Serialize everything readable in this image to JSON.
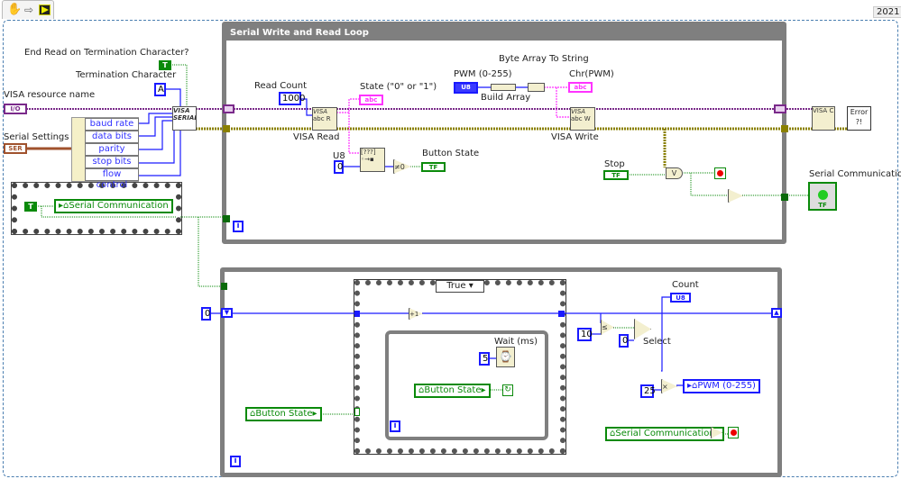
{
  "toolbar": {
    "icons": [
      "hand-icon",
      "step-arrow-icon",
      "run-vi-icon"
    ],
    "version": "2021"
  },
  "top_left": {
    "end_read_label": "End Read on Termination Character?",
    "end_read_value": "T",
    "term_char_label": "Termination Character",
    "term_char_value": "A",
    "visa_resource_label": "VISA resource name",
    "visa_resource_type": "I/O",
    "serial_settings_label": "Serial Settings",
    "serial_settings_type": "SER",
    "cluster_items": [
      "baud rate",
      "data bits",
      "parity",
      "stop bits",
      "flow control"
    ],
    "visa_config_label": "VISA SERIAL",
    "seq_const": "T",
    "seq_local": "Serial Communication"
  },
  "loop1": {
    "title": "Serial Write and Read Loop",
    "read_count_label": "Read Count",
    "read_count_value": "1000",
    "visa_read_label": "VISA Read",
    "state_label": "State (\"0\" or \"1\")",
    "state_type": "abc",
    "u8_label": "U8",
    "u8_value": "0",
    "neq0": "≠0",
    "button_state_label": "Button State",
    "button_state_type": "TF",
    "byte_array_label": "Byte Array To String",
    "pwm_label": "PWM (0-255)",
    "pwm_type": "U8",
    "build_array_label": "Build Array",
    "chr_label": "Chr(PWM)",
    "chr_type": "abc",
    "visa_write_label": "VISA Write",
    "stop_label": "Stop",
    "stop_type": "TF",
    "or_glyph": "V",
    "iter": "i",
    "visa_close_label": "VISA C",
    "error_label": "Error ?!",
    "serial_comm_label": "Serial Communication",
    "serial_comm_type": "TF",
    "serial_comm_led_color": "#22cc22"
  },
  "loop2": {
    "init_value": "0",
    "case_selector": "True",
    "increment": "+1",
    "wait_label": "Wait (ms)",
    "wait_value": "5",
    "inner_local": "Button State",
    "outer_local": "Button State",
    "compare_value": "10",
    "zero_value": "0",
    "select_label": "Select",
    "count_label": "Count",
    "count_type": "U8",
    "mult_value": "25",
    "mult_glyph": "×",
    "pwm_local": "PWM (0-255)",
    "serial_local": "Serial Communication",
    "iter": "i"
  },
  "colors": {
    "numeric": "#1a1aff",
    "boolean": "#0a8a0a",
    "string": "#ff33ff",
    "visa": "#7a2a8a",
    "error": "#8a8000",
    "cluster": "#a0522d",
    "loop": "#7f7f7f"
  }
}
